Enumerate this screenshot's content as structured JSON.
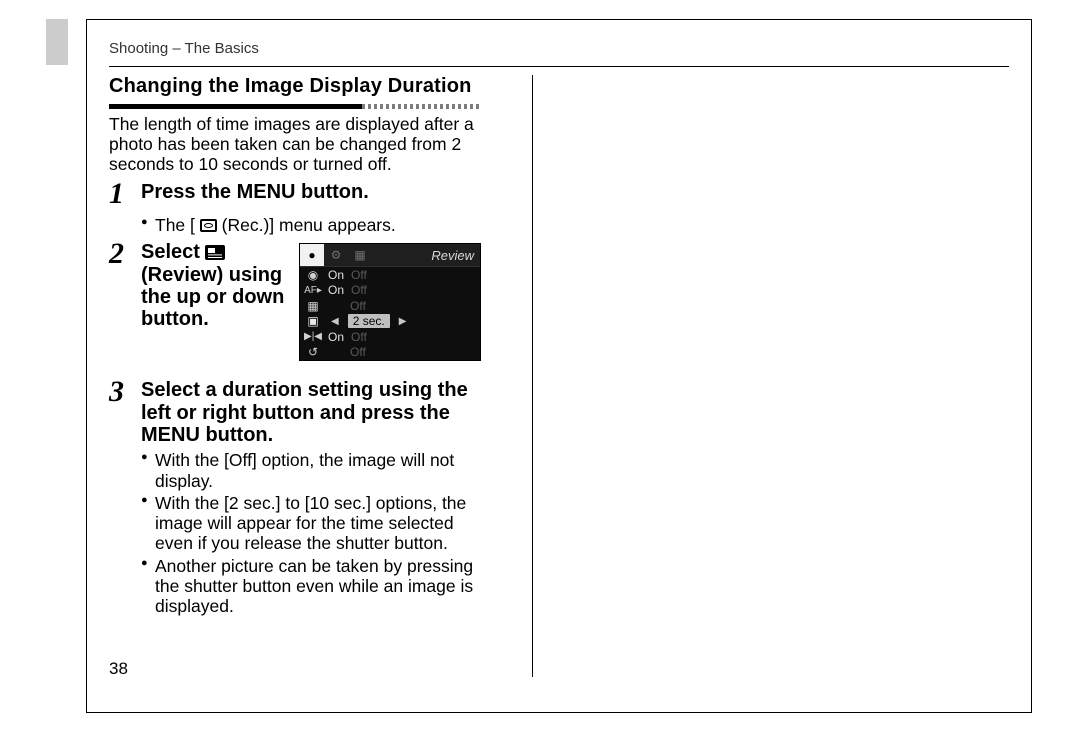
{
  "header": {
    "running_head": "Shooting – The Basics"
  },
  "section": {
    "title": "Changing the Image Display Duration",
    "intro": "The length of time images are displayed after a photo has been taken can be changed from 2 seconds to 10 seconds or turned off."
  },
  "steps": {
    "s1": {
      "num": "1",
      "title": "Press the MENU button.",
      "bullets": [
        "The [",
        "(Rec.)] menu appears."
      ]
    },
    "s2": {
      "num": "2",
      "title_pre": "Select ",
      "title_post": " (Review) using the up or down button."
    },
    "s3": {
      "num": "3",
      "title": "Select a duration setting using the left or right button and press the MENU button.",
      "bullets": [
        "With the [Off] option, the image will not display.",
        "With the [2 sec.] to [10 sec.] options, the image will appear for the time selected even if you release the shutter button.",
        "Another picture can be taken by pressing the shutter button even while an image is displayed."
      ]
    }
  },
  "lcd": {
    "title": "Review",
    "tab_icons": [
      "●",
      "⚙",
      "▦"
    ],
    "rows": [
      {
        "icon": "◉",
        "on": "On",
        "off": "Off",
        "type": "onoff"
      },
      {
        "icon": "AF▸",
        "on": "On",
        "off": "Off",
        "type": "onoff"
      },
      {
        "icon": "▦",
        "on": "",
        "off": "Off",
        "type": "single_off"
      },
      {
        "icon": "▣",
        "value": "2 sec.",
        "type": "selected"
      },
      {
        "icon": "▶|◀",
        "on": "On",
        "off": "Off",
        "type": "onoff"
      },
      {
        "icon": "↺",
        "on": "",
        "off": "Off",
        "type": "single_off"
      }
    ]
  },
  "footer": {
    "page_number": "38"
  }
}
